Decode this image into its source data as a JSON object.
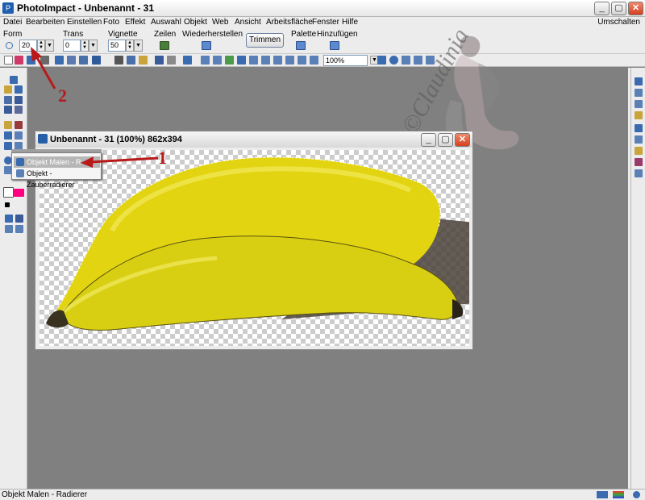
{
  "window": {
    "title": "PhotoImpact - Unbenannt - 31",
    "min": "_",
    "max": "▢",
    "close": "✕"
  },
  "menu": [
    "Datei",
    "Bearbeiten",
    "Einstellen",
    "Foto",
    "Effekt",
    "Auswahl",
    "Objekt",
    "Web",
    "Ansicht",
    "Arbeitsfläche",
    "Fenster",
    "Hilfe"
  ],
  "menu_right": "Umschalten",
  "options": {
    "form_label": "Form",
    "form_value": "20",
    "trans_label": "Trans",
    "trans_value": "0",
    "vignette_label": "Vignette",
    "vignette_value": "50",
    "zeilen_label": "Zeilen",
    "wiederherstellen_label": "Wiederherstellen",
    "trimmen_label": "Trimmen",
    "palette_label": "Palette",
    "hinzufuegen_label": "Hinzufügen"
  },
  "toolbar": {
    "zoom_value": "100%"
  },
  "document": {
    "title": "Unbenannt - 31 (100%) 862x394"
  },
  "popup": {
    "item1": "Objekt Malen - R",
    "item2": "Objekt - Zauberradierer"
  },
  "status": {
    "text": "Objekt Malen - Radierer"
  },
  "annotations": {
    "one": "1",
    "two": "2"
  },
  "watermark": {
    "text": "©Claudinia"
  },
  "colors": {
    "foreground": "#ffffff",
    "background": "#ff0080"
  }
}
